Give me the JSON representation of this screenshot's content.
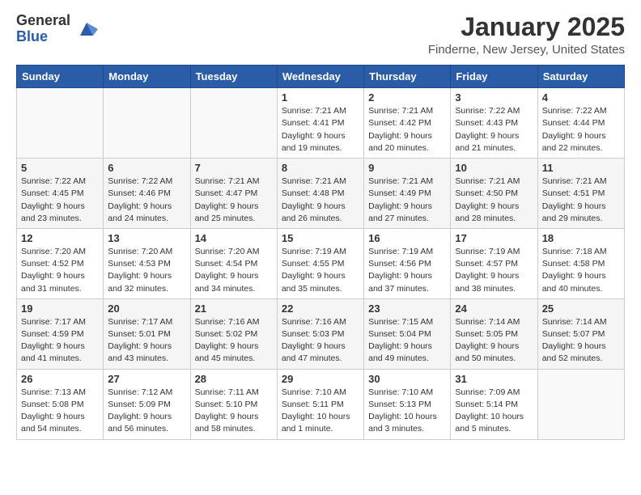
{
  "header": {
    "logo_general": "General",
    "logo_blue": "Blue",
    "month": "January 2025",
    "location": "Finderne, New Jersey, United States"
  },
  "days_of_week": [
    "Sunday",
    "Monday",
    "Tuesday",
    "Wednesday",
    "Thursday",
    "Friday",
    "Saturday"
  ],
  "weeks": [
    [
      {
        "day": "",
        "content": ""
      },
      {
        "day": "",
        "content": ""
      },
      {
        "day": "",
        "content": ""
      },
      {
        "day": "1",
        "content": "Sunrise: 7:21 AM\nSunset: 4:41 PM\nDaylight: 9 hours\nand 19 minutes."
      },
      {
        "day": "2",
        "content": "Sunrise: 7:21 AM\nSunset: 4:42 PM\nDaylight: 9 hours\nand 20 minutes."
      },
      {
        "day": "3",
        "content": "Sunrise: 7:22 AM\nSunset: 4:43 PM\nDaylight: 9 hours\nand 21 minutes."
      },
      {
        "day": "4",
        "content": "Sunrise: 7:22 AM\nSunset: 4:44 PM\nDaylight: 9 hours\nand 22 minutes."
      }
    ],
    [
      {
        "day": "5",
        "content": "Sunrise: 7:22 AM\nSunset: 4:45 PM\nDaylight: 9 hours\nand 23 minutes."
      },
      {
        "day": "6",
        "content": "Sunrise: 7:22 AM\nSunset: 4:46 PM\nDaylight: 9 hours\nand 24 minutes."
      },
      {
        "day": "7",
        "content": "Sunrise: 7:21 AM\nSunset: 4:47 PM\nDaylight: 9 hours\nand 25 minutes."
      },
      {
        "day": "8",
        "content": "Sunrise: 7:21 AM\nSunset: 4:48 PM\nDaylight: 9 hours\nand 26 minutes."
      },
      {
        "day": "9",
        "content": "Sunrise: 7:21 AM\nSunset: 4:49 PM\nDaylight: 9 hours\nand 27 minutes."
      },
      {
        "day": "10",
        "content": "Sunrise: 7:21 AM\nSunset: 4:50 PM\nDaylight: 9 hours\nand 28 minutes."
      },
      {
        "day": "11",
        "content": "Sunrise: 7:21 AM\nSunset: 4:51 PM\nDaylight: 9 hours\nand 29 minutes."
      }
    ],
    [
      {
        "day": "12",
        "content": "Sunrise: 7:20 AM\nSunset: 4:52 PM\nDaylight: 9 hours\nand 31 minutes."
      },
      {
        "day": "13",
        "content": "Sunrise: 7:20 AM\nSunset: 4:53 PM\nDaylight: 9 hours\nand 32 minutes."
      },
      {
        "day": "14",
        "content": "Sunrise: 7:20 AM\nSunset: 4:54 PM\nDaylight: 9 hours\nand 34 minutes."
      },
      {
        "day": "15",
        "content": "Sunrise: 7:19 AM\nSunset: 4:55 PM\nDaylight: 9 hours\nand 35 minutes."
      },
      {
        "day": "16",
        "content": "Sunrise: 7:19 AM\nSunset: 4:56 PM\nDaylight: 9 hours\nand 37 minutes."
      },
      {
        "day": "17",
        "content": "Sunrise: 7:19 AM\nSunset: 4:57 PM\nDaylight: 9 hours\nand 38 minutes."
      },
      {
        "day": "18",
        "content": "Sunrise: 7:18 AM\nSunset: 4:58 PM\nDaylight: 9 hours\nand 40 minutes."
      }
    ],
    [
      {
        "day": "19",
        "content": "Sunrise: 7:17 AM\nSunset: 4:59 PM\nDaylight: 9 hours\nand 41 minutes."
      },
      {
        "day": "20",
        "content": "Sunrise: 7:17 AM\nSunset: 5:01 PM\nDaylight: 9 hours\nand 43 minutes."
      },
      {
        "day": "21",
        "content": "Sunrise: 7:16 AM\nSunset: 5:02 PM\nDaylight: 9 hours\nand 45 minutes."
      },
      {
        "day": "22",
        "content": "Sunrise: 7:16 AM\nSunset: 5:03 PM\nDaylight: 9 hours\nand 47 minutes."
      },
      {
        "day": "23",
        "content": "Sunrise: 7:15 AM\nSunset: 5:04 PM\nDaylight: 9 hours\nand 49 minutes."
      },
      {
        "day": "24",
        "content": "Sunrise: 7:14 AM\nSunset: 5:05 PM\nDaylight: 9 hours\nand 50 minutes."
      },
      {
        "day": "25",
        "content": "Sunrise: 7:14 AM\nSunset: 5:07 PM\nDaylight: 9 hours\nand 52 minutes."
      }
    ],
    [
      {
        "day": "26",
        "content": "Sunrise: 7:13 AM\nSunset: 5:08 PM\nDaylight: 9 hours\nand 54 minutes."
      },
      {
        "day": "27",
        "content": "Sunrise: 7:12 AM\nSunset: 5:09 PM\nDaylight: 9 hours\nand 56 minutes."
      },
      {
        "day": "28",
        "content": "Sunrise: 7:11 AM\nSunset: 5:10 PM\nDaylight: 9 hours\nand 58 minutes."
      },
      {
        "day": "29",
        "content": "Sunrise: 7:10 AM\nSunset: 5:11 PM\nDaylight: 10 hours\nand 1 minute."
      },
      {
        "day": "30",
        "content": "Sunrise: 7:10 AM\nSunset: 5:13 PM\nDaylight: 10 hours\nand 3 minutes."
      },
      {
        "day": "31",
        "content": "Sunrise: 7:09 AM\nSunset: 5:14 PM\nDaylight: 10 hours\nand 5 minutes."
      },
      {
        "day": "",
        "content": ""
      }
    ]
  ]
}
